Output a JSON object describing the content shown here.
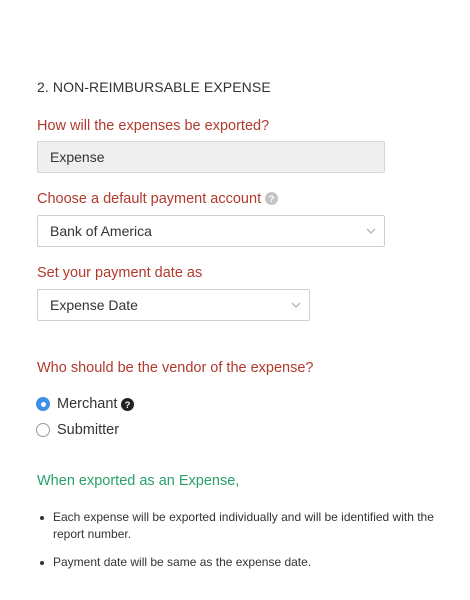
{
  "section": {
    "title": "2. NON-REIMBURSABLE EXPENSE"
  },
  "export_type": {
    "label": "How will the expenses be exported?",
    "value": "Expense"
  },
  "payment_account": {
    "label": "Choose a default payment account",
    "value": "Bank of America",
    "help_icon": "question-circle-icon"
  },
  "payment_date": {
    "label": "Set your payment date as",
    "value": "Expense Date"
  },
  "vendor": {
    "label": "Who should be the vendor of the expense?",
    "options": [
      {
        "label": "Merchant",
        "selected": true,
        "help_icon": "question-circle-icon"
      },
      {
        "label": "Submitter",
        "selected": false
      }
    ]
  },
  "info": {
    "title": "When exported as an Expense,",
    "bullets": [
      "Each expense will be exported individually and will be identified with the report number.",
      "Payment date will be same as the expense date."
    ]
  },
  "colors": {
    "question_label": "#b03a2e",
    "info_title": "#2aa06b",
    "radio_selected": "#3d8fe8"
  }
}
